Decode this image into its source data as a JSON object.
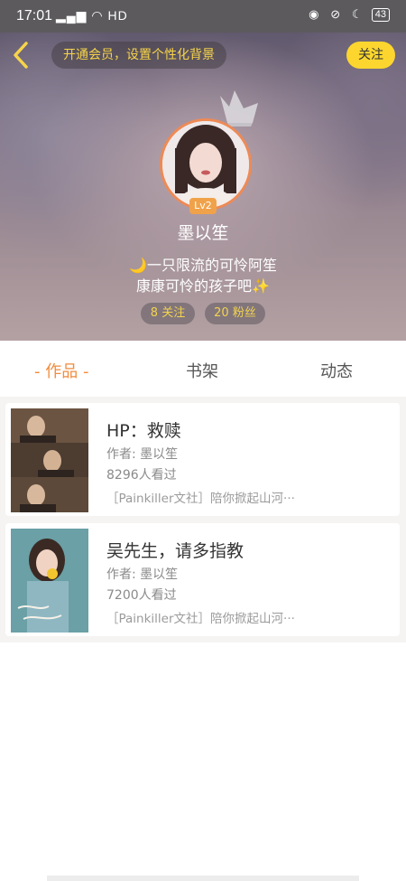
{
  "status_bar": {
    "time": "17:01",
    "network": "HD",
    "battery": "43"
  },
  "header": {
    "vip_banner": "开通会员，设置个性化背景",
    "follow_button": "关注"
  },
  "profile": {
    "level": "Lv2",
    "nickname": "墨以笙",
    "bio_line1": "🌙一只限流的可怜阿笙",
    "bio_line2": "康康可怜的孩子吧✨",
    "following": "8 关注",
    "fans": "20 粉丝"
  },
  "tabs": {
    "works": "作品",
    "shelf": "书架",
    "feed": "动态",
    "dash_left": "-",
    "dash_right": "-"
  },
  "books": [
    {
      "title": "HP：救赎",
      "author": "作者: 墨以笙",
      "views": "8296人看过",
      "tag": "［Painkiller文社］陪你掀起山河···"
    },
    {
      "title": "吴先生，请多指教",
      "author": "作者: 墨以笙",
      "views": "7200人看过",
      "tag": "［Painkiller文社］陪你掀起山河···"
    }
  ],
  "colors": {
    "accent_orange": "#f28c3d",
    "follow_yellow": "#fcd62e",
    "vip_text": "#f7d44a"
  }
}
